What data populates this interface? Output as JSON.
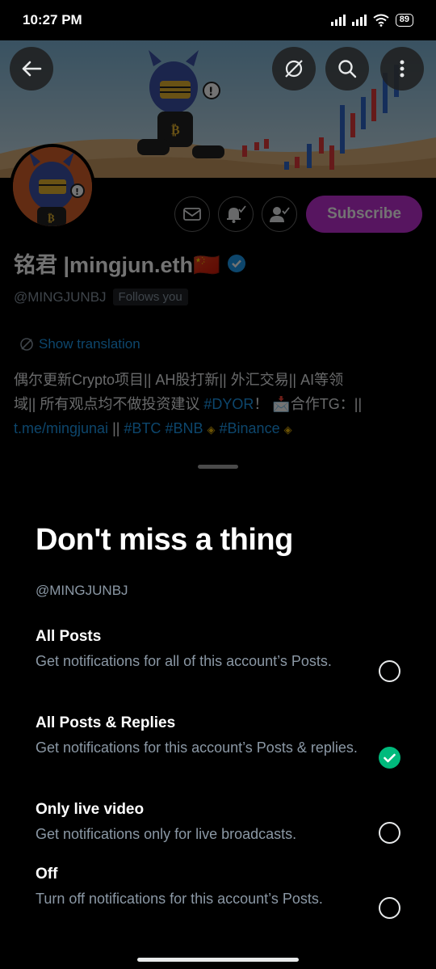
{
  "status_bar": {
    "time": "10:27 PM",
    "battery": "89"
  },
  "profile": {
    "name": "铭君 |mingjun.eth🇨🇳",
    "handle": "@MINGJUNBJ",
    "follows_badge": "Follows you",
    "show_translation": "Show translation",
    "bio_line1": "偶尔更新Crypto项目|| AH股打新|| 外汇交易|| AI等领",
    "bio_line2_text": "域|| 所有观点均不做投资建议 ",
    "bio_line2_tag": "#DYOR",
    "bio_line2_tail": "！  📩合作TG：||",
    "bio_line3_link": "t.me/mingjunai",
    "bio_line3_sep": " ||  ",
    "bio_tag_btc": "#BTC",
    "bio_tag_bnb": "#BNB",
    "bio_tag_binance": "#Binance",
    "subscribe_label": "Subscribe"
  },
  "sheet": {
    "title": "Don't miss a thing",
    "handle": "@MINGJUNBJ",
    "options": [
      {
        "title": "All Posts",
        "desc": "Get notifications for all of this account’s Posts.",
        "checked": false
      },
      {
        "title": "All Posts & Replies",
        "desc": "Get notifications for this account’s Posts & replies.",
        "checked": true
      },
      {
        "title": "Only live video",
        "desc": "Get notifications only for live broadcasts.",
        "checked": false
      },
      {
        "title": "Off",
        "desc": "Turn off notifications for this account’s Posts.",
        "checked": false
      }
    ]
  },
  "colors": {
    "accent": "#1d9bf0",
    "subscribe": "#c22fd6",
    "checked": "#00ba7c"
  }
}
